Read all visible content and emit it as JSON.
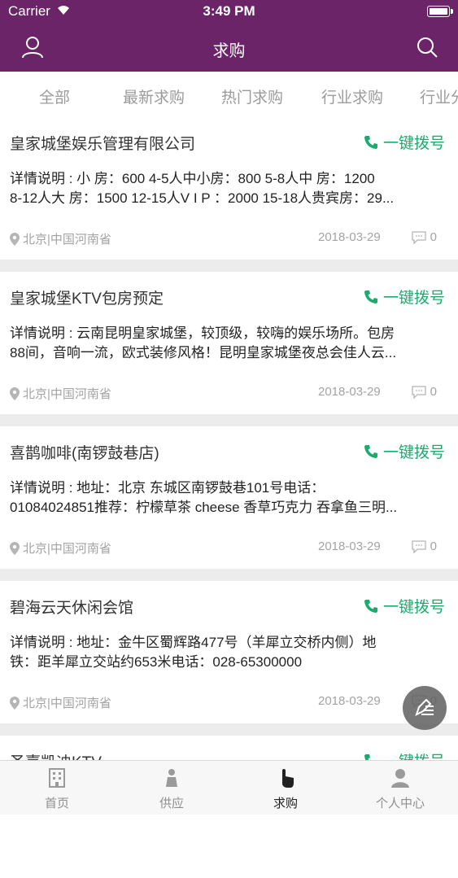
{
  "status_bar": {
    "carrier": "Carrier",
    "time": "3:49 PM"
  },
  "navbar": {
    "title": "求购",
    "left_icon": "user-icon",
    "right_icon": "search-icon"
  },
  "tabs": [
    {
      "label": "全部"
    },
    {
      "label": "最新求购"
    },
    {
      "label": "热门求购"
    },
    {
      "label": "行业求购"
    },
    {
      "label": "行业分"
    }
  ],
  "cards": [
    {
      "name": "皇家城堡娱乐管理有限公司",
      "call_label": "一键拨号",
      "desc_line1": "详情说明 : 小 房：600 4-5人中小房：800 5-8人中 房：1200",
      "desc_line2": "8-12人大 房：1500 12-15人V I P ：2000 15-18人贵宾房：29...",
      "location": "北京|中国河南省",
      "date": "2018-03-29",
      "comments": "0"
    },
    {
      "name": "皇家城堡KTV包房预定",
      "call_label": "一键拨号",
      "desc_line1": "详情说明 : 云南昆明皇家城堡，较顶级，较嗨的娱乐场所。包房",
      "desc_line2": "88间，音响一流，欧式装修风格！昆明皇家城堡夜总会佳人云...",
      "location": "北京|中国河南省",
      "date": "2018-03-29",
      "comments": "0"
    },
    {
      "name": "喜鹊咖啡(南锣鼓巷店)",
      "call_label": "一键拨号",
      "desc_line1": "详情说明 : 地址：北京 东城区南锣鼓巷101号电话：",
      "desc_line2": "01084024851推荐：柠檬草茶 cheese 香草巧克力 吞拿鱼三明...",
      "location": "北京|中国河南省",
      "date": "2018-03-29",
      "comments": "0"
    },
    {
      "name": "碧海云天休闲会馆",
      "call_label": "一键拨号",
      "desc_line1": "详情说明 : 地址：金牛区蜀辉路477号（羊犀立交桥内侧）地",
      "desc_line2": "铁：距羊犀立交站约653米电话：028-65300000",
      "location": "北京|中国河南省",
      "date": "2018-03-29",
      "comments": "0"
    },
    {
      "name": "圣嘉凯迪KTV",
      "call_label": "一键拨号",
      "desc_line1": "",
      "desc_line2": "",
      "location": "",
      "date": "",
      "comments": ""
    }
  ],
  "tabbar": [
    {
      "label": "首页",
      "icon": "building-icon"
    },
    {
      "label": "供应",
      "icon": "person-icon"
    },
    {
      "label": "求购",
      "icon": "hand-tap-icon",
      "active": true
    },
    {
      "label": "个人中心",
      "icon": "profile-icon"
    }
  ],
  "colors": {
    "primary": "#6a2467",
    "call": "#1aab6d",
    "muted": "#a3a3a3"
  }
}
